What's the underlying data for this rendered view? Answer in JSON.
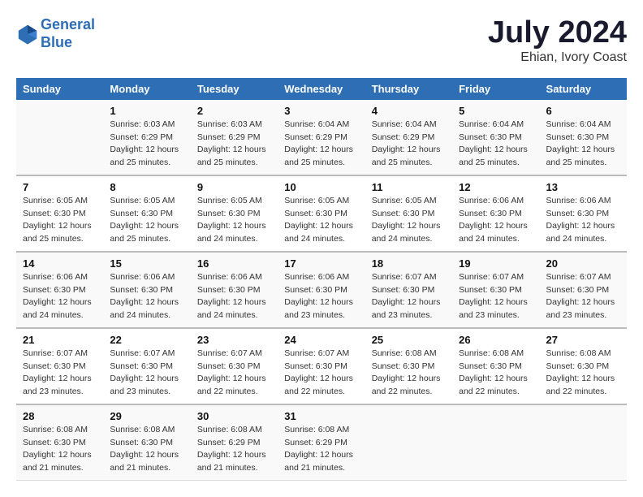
{
  "header": {
    "logo_line1": "General",
    "logo_line2": "Blue",
    "month": "July 2024",
    "location": "Ehian, Ivory Coast"
  },
  "days_of_week": [
    "Sunday",
    "Monday",
    "Tuesday",
    "Wednesday",
    "Thursday",
    "Friday",
    "Saturday"
  ],
  "weeks": [
    [
      {
        "day": "",
        "sunrise": "",
        "sunset": "",
        "daylight": ""
      },
      {
        "day": "1",
        "sunrise": "Sunrise: 6:03 AM",
        "sunset": "Sunset: 6:29 PM",
        "daylight": "Daylight: 12 hours and 25 minutes."
      },
      {
        "day": "2",
        "sunrise": "Sunrise: 6:03 AM",
        "sunset": "Sunset: 6:29 PM",
        "daylight": "Daylight: 12 hours and 25 minutes."
      },
      {
        "day": "3",
        "sunrise": "Sunrise: 6:04 AM",
        "sunset": "Sunset: 6:29 PM",
        "daylight": "Daylight: 12 hours and 25 minutes."
      },
      {
        "day": "4",
        "sunrise": "Sunrise: 6:04 AM",
        "sunset": "Sunset: 6:29 PM",
        "daylight": "Daylight: 12 hours and 25 minutes."
      },
      {
        "day": "5",
        "sunrise": "Sunrise: 6:04 AM",
        "sunset": "Sunset: 6:30 PM",
        "daylight": "Daylight: 12 hours and 25 minutes."
      },
      {
        "day": "6",
        "sunrise": "Sunrise: 6:04 AM",
        "sunset": "Sunset: 6:30 PM",
        "daylight": "Daylight: 12 hours and 25 minutes."
      }
    ],
    [
      {
        "day": "7",
        "sunrise": "Sunrise: 6:05 AM",
        "sunset": "Sunset: 6:30 PM",
        "daylight": "Daylight: 12 hours and 25 minutes."
      },
      {
        "day": "8",
        "sunrise": "Sunrise: 6:05 AM",
        "sunset": "Sunset: 6:30 PM",
        "daylight": "Daylight: 12 hours and 25 minutes."
      },
      {
        "day": "9",
        "sunrise": "Sunrise: 6:05 AM",
        "sunset": "Sunset: 6:30 PM",
        "daylight": "Daylight: 12 hours and 24 minutes."
      },
      {
        "day": "10",
        "sunrise": "Sunrise: 6:05 AM",
        "sunset": "Sunset: 6:30 PM",
        "daylight": "Daylight: 12 hours and 24 minutes."
      },
      {
        "day": "11",
        "sunrise": "Sunrise: 6:05 AM",
        "sunset": "Sunset: 6:30 PM",
        "daylight": "Daylight: 12 hours and 24 minutes."
      },
      {
        "day": "12",
        "sunrise": "Sunrise: 6:06 AM",
        "sunset": "Sunset: 6:30 PM",
        "daylight": "Daylight: 12 hours and 24 minutes."
      },
      {
        "day": "13",
        "sunrise": "Sunrise: 6:06 AM",
        "sunset": "Sunset: 6:30 PM",
        "daylight": "Daylight: 12 hours and 24 minutes."
      }
    ],
    [
      {
        "day": "14",
        "sunrise": "Sunrise: 6:06 AM",
        "sunset": "Sunset: 6:30 PM",
        "daylight": "Daylight: 12 hours and 24 minutes."
      },
      {
        "day": "15",
        "sunrise": "Sunrise: 6:06 AM",
        "sunset": "Sunset: 6:30 PM",
        "daylight": "Daylight: 12 hours and 24 minutes."
      },
      {
        "day": "16",
        "sunrise": "Sunrise: 6:06 AM",
        "sunset": "Sunset: 6:30 PM",
        "daylight": "Daylight: 12 hours and 24 minutes."
      },
      {
        "day": "17",
        "sunrise": "Sunrise: 6:06 AM",
        "sunset": "Sunset: 6:30 PM",
        "daylight": "Daylight: 12 hours and 23 minutes."
      },
      {
        "day": "18",
        "sunrise": "Sunrise: 6:07 AM",
        "sunset": "Sunset: 6:30 PM",
        "daylight": "Daylight: 12 hours and 23 minutes."
      },
      {
        "day": "19",
        "sunrise": "Sunrise: 6:07 AM",
        "sunset": "Sunset: 6:30 PM",
        "daylight": "Daylight: 12 hours and 23 minutes."
      },
      {
        "day": "20",
        "sunrise": "Sunrise: 6:07 AM",
        "sunset": "Sunset: 6:30 PM",
        "daylight": "Daylight: 12 hours and 23 minutes."
      }
    ],
    [
      {
        "day": "21",
        "sunrise": "Sunrise: 6:07 AM",
        "sunset": "Sunset: 6:30 PM",
        "daylight": "Daylight: 12 hours and 23 minutes."
      },
      {
        "day": "22",
        "sunrise": "Sunrise: 6:07 AM",
        "sunset": "Sunset: 6:30 PM",
        "daylight": "Daylight: 12 hours and 23 minutes."
      },
      {
        "day": "23",
        "sunrise": "Sunrise: 6:07 AM",
        "sunset": "Sunset: 6:30 PM",
        "daylight": "Daylight: 12 hours and 22 minutes."
      },
      {
        "day": "24",
        "sunrise": "Sunrise: 6:07 AM",
        "sunset": "Sunset: 6:30 PM",
        "daylight": "Daylight: 12 hours and 22 minutes."
      },
      {
        "day": "25",
        "sunrise": "Sunrise: 6:08 AM",
        "sunset": "Sunset: 6:30 PM",
        "daylight": "Daylight: 12 hours and 22 minutes."
      },
      {
        "day": "26",
        "sunrise": "Sunrise: 6:08 AM",
        "sunset": "Sunset: 6:30 PM",
        "daylight": "Daylight: 12 hours and 22 minutes."
      },
      {
        "day": "27",
        "sunrise": "Sunrise: 6:08 AM",
        "sunset": "Sunset: 6:30 PM",
        "daylight": "Daylight: 12 hours and 22 minutes."
      }
    ],
    [
      {
        "day": "28",
        "sunrise": "Sunrise: 6:08 AM",
        "sunset": "Sunset: 6:30 PM",
        "daylight": "Daylight: 12 hours and 21 minutes."
      },
      {
        "day": "29",
        "sunrise": "Sunrise: 6:08 AM",
        "sunset": "Sunset: 6:30 PM",
        "daylight": "Daylight: 12 hours and 21 minutes."
      },
      {
        "day": "30",
        "sunrise": "Sunrise: 6:08 AM",
        "sunset": "Sunset: 6:29 PM",
        "daylight": "Daylight: 12 hours and 21 minutes."
      },
      {
        "day": "31",
        "sunrise": "Sunrise: 6:08 AM",
        "sunset": "Sunset: 6:29 PM",
        "daylight": "Daylight: 12 hours and 21 minutes."
      },
      {
        "day": "",
        "sunrise": "",
        "sunset": "",
        "daylight": ""
      },
      {
        "day": "",
        "sunrise": "",
        "sunset": "",
        "daylight": ""
      },
      {
        "day": "",
        "sunrise": "",
        "sunset": "",
        "daylight": ""
      }
    ]
  ]
}
